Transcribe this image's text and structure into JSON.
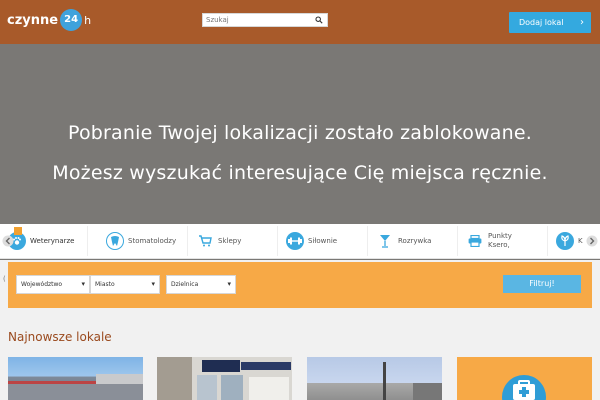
{
  "header": {
    "logo_text": "czynne",
    "logo_badge": "24",
    "logo_suffix": "h",
    "search_placeholder": "Szukaj",
    "add_button": "Dodaj lokal"
  },
  "hero": {
    "line1": "Pobranie Twojej lokalizacji zostało zablokowane.",
    "line2": "Możesz wyszukać interesujące Cię miejsca ręcznie."
  },
  "categories": [
    {
      "label": "Weterynarze",
      "icon": "paw-icon"
    },
    {
      "label": "Stomatolodzy",
      "icon": "tooth-icon"
    },
    {
      "label": "Sklepy",
      "icon": "cart-icon"
    },
    {
      "label": "Siłownie",
      "icon": "dumbbell-icon"
    },
    {
      "label": "Rozrywka",
      "icon": "cocktail-icon"
    },
    {
      "label": "Punkty Ksero,",
      "icon": "printer-icon"
    },
    {
      "label": "K",
      "icon": "plant-icon"
    }
  ],
  "filter": {
    "wojewodztwo": "Województwo",
    "miasto": "Miasto",
    "dzielnica": "Dzielnica",
    "button": "Filtruj!"
  },
  "news": {
    "title": "Najnowsze lokale"
  },
  "colors": {
    "header": "#a85a2a",
    "hero": "#7a7875",
    "accent": "#34a9df",
    "filter": "#f7a946"
  }
}
